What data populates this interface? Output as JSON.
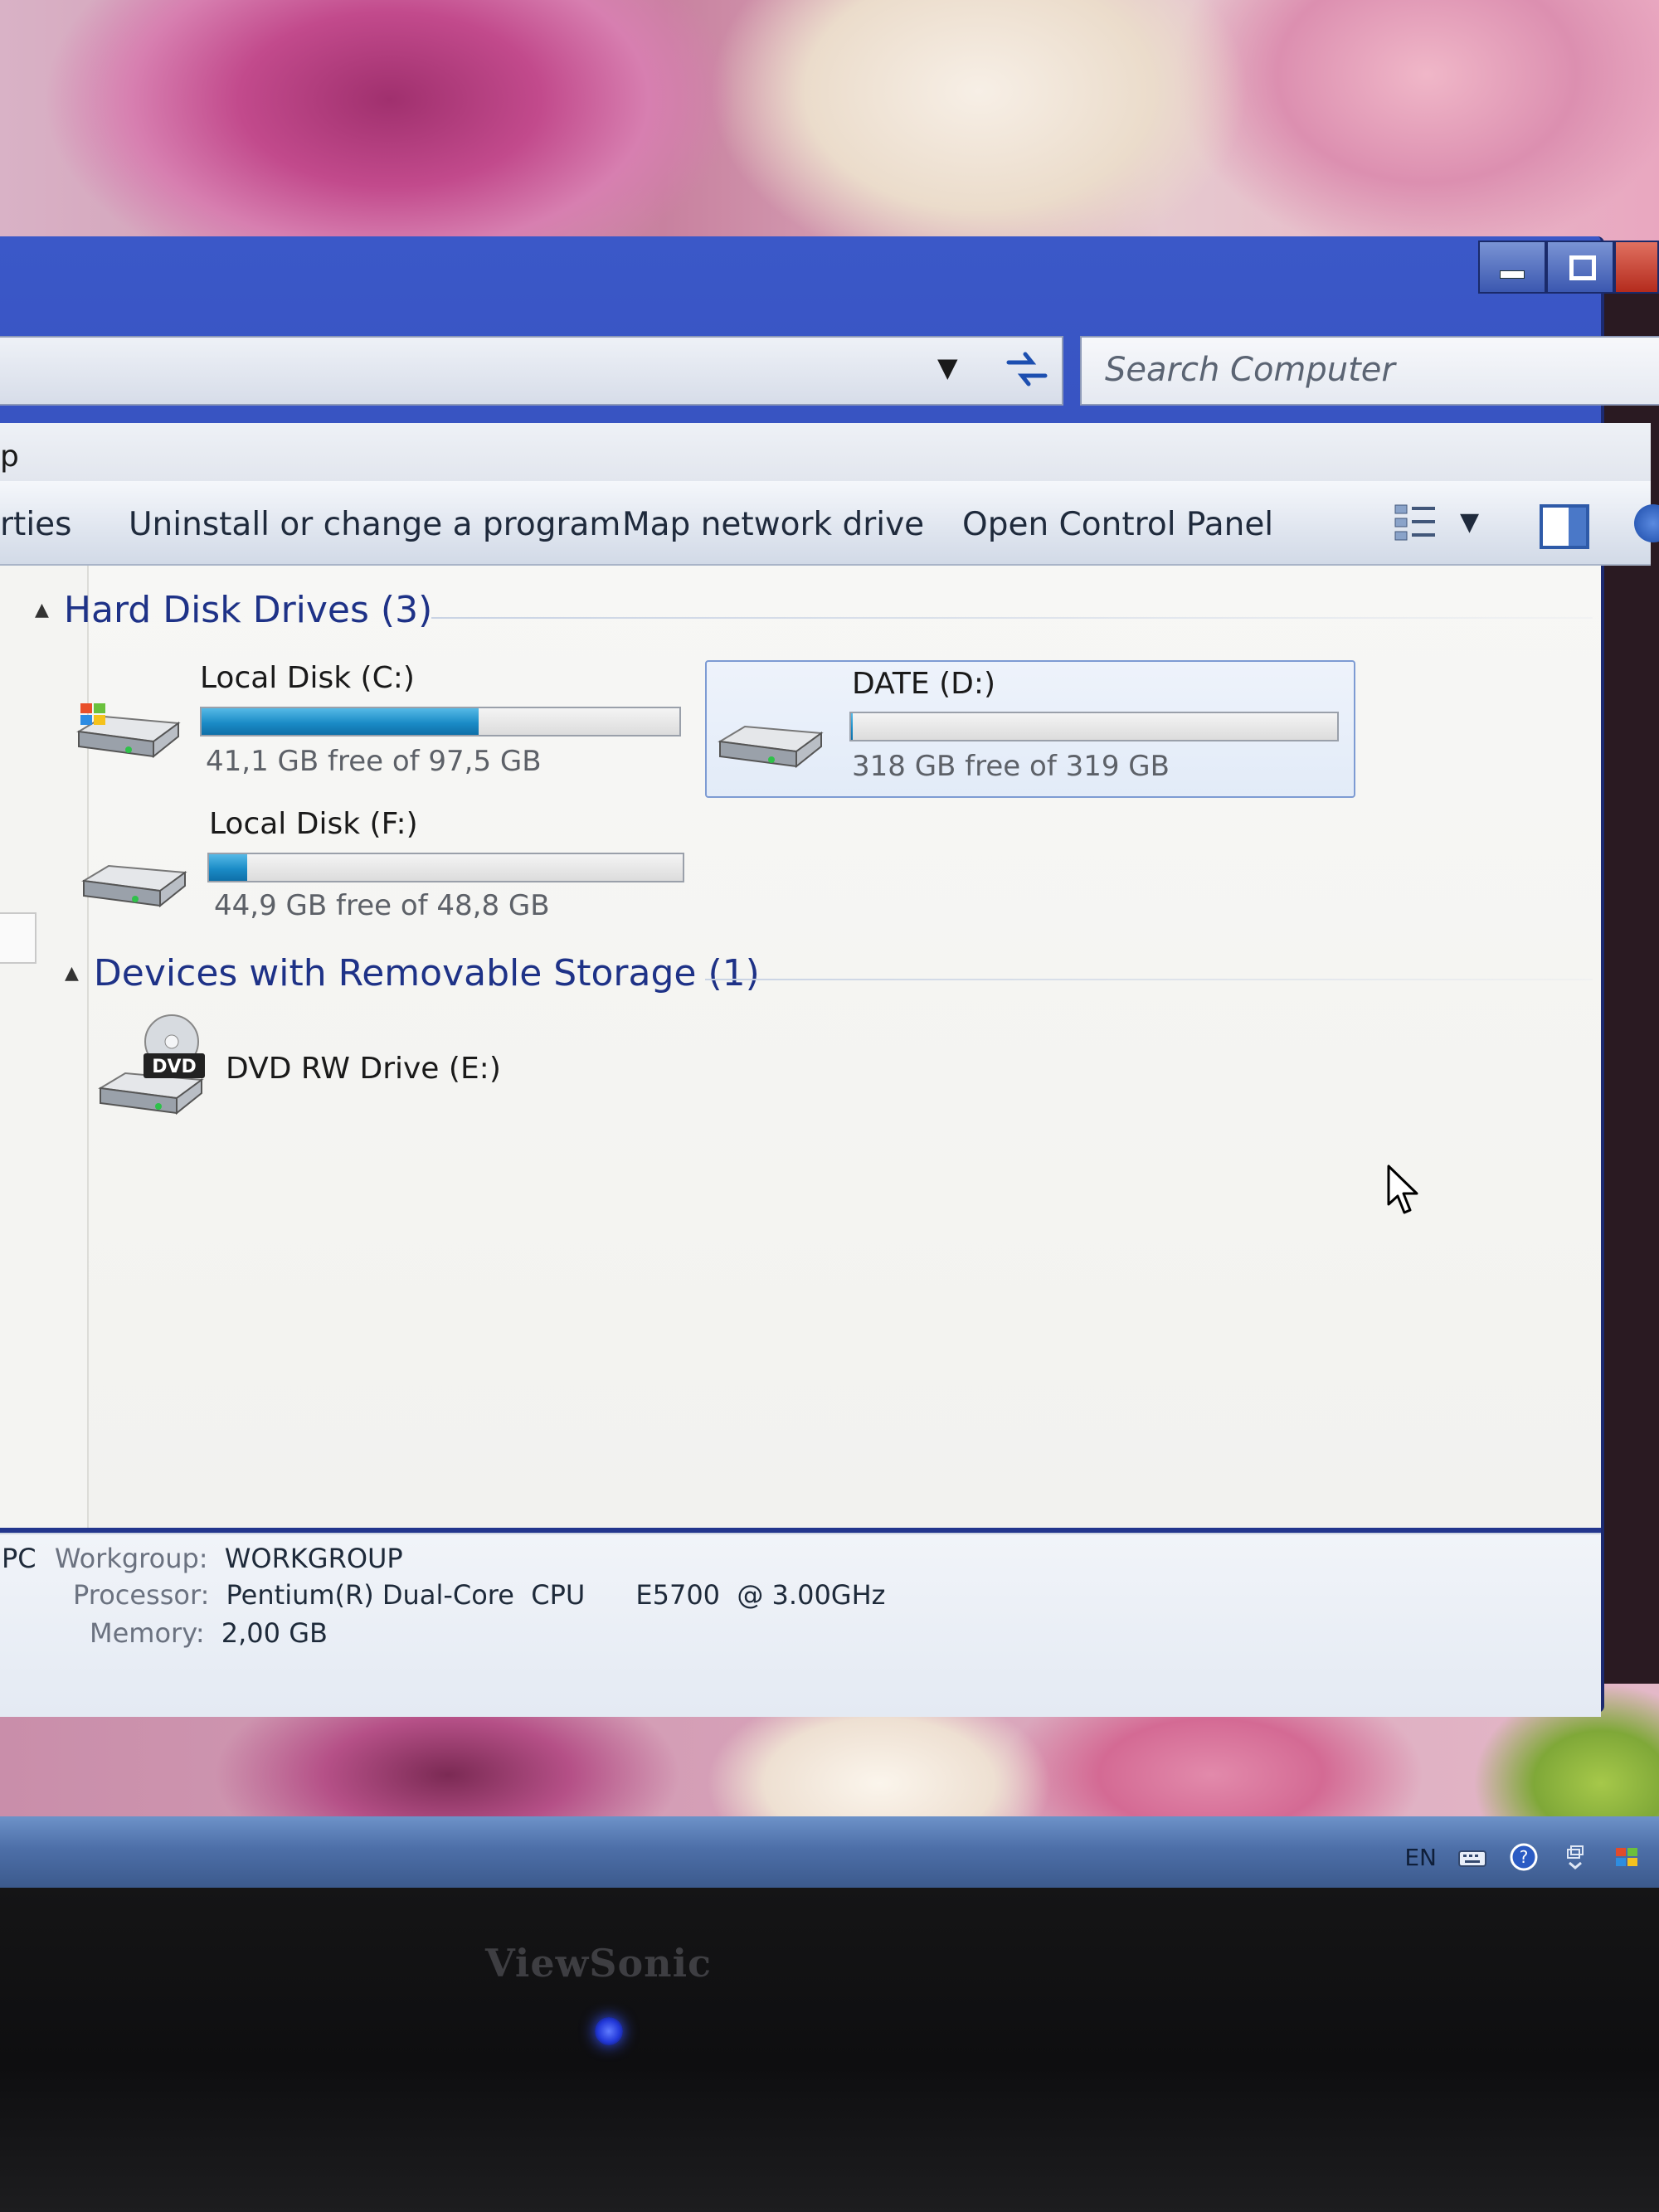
{
  "window": {
    "search_placeholder": "Search Computer",
    "menu_fragment": "p"
  },
  "toolbar": {
    "properties_fragment": "rties",
    "uninstall": "Uninstall or change a program",
    "map_drive": "Map network drive",
    "control_panel": "Open Control Panel"
  },
  "groups": {
    "hdd": {
      "title": "Hard Disk Drives (3)",
      "drives": [
        {
          "name": "Local Disk (C:)",
          "free_text": "41,1 GB free of 97,5 GB",
          "used_fraction": 0.58,
          "icon": "system-drive-icon"
        },
        {
          "name": "DATE (D:)",
          "free_text": "318 GB free of 319 GB",
          "used_fraction": 0.003,
          "icon": "hard-drive-icon",
          "selected": true
        },
        {
          "name": "Local Disk (F:)",
          "free_text": "44,9 GB free of 48,8 GB",
          "used_fraction": 0.08,
          "icon": "hard-drive-icon"
        }
      ]
    },
    "removable": {
      "title": "Devices with Removable Storage (1)",
      "devices": [
        {
          "name": "DVD RW Drive (E:)",
          "icon": "dvd-drive-icon",
          "badge": "DVD"
        }
      ]
    }
  },
  "details": {
    "pc_fragment": "PC",
    "workgroup_label": "Workgroup:",
    "workgroup_value": "WORKGROUP",
    "processor_label": "Processor:",
    "processor_value": "Pentium(R) Dual-Core  CPU      E5700  @ 3.00GHz",
    "memory_label": "Memory:",
    "memory_value": "2,00 GB"
  },
  "taskbar": {
    "language": "EN"
  },
  "monitor": {
    "brand": "ViewSonic"
  },
  "colors": {
    "titlebar": "#2941a8",
    "group_header": "#1e3287",
    "usage_bar": "#1b8cc7",
    "selection": "#7d9bd3"
  }
}
